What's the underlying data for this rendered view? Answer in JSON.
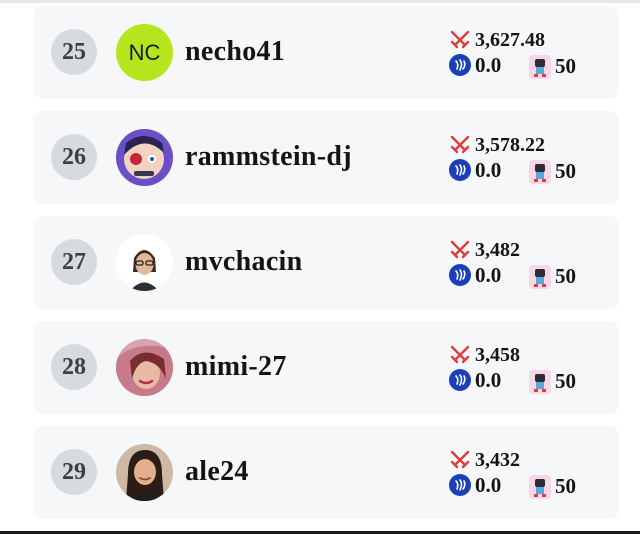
{
  "rows": [
    {
      "rank": "25",
      "username": "necho41",
      "avatar": {
        "kind": "initials",
        "initials": "NC",
        "bg": "#b5e61d"
      },
      "battle_power": "3,627.48",
      "steem_balance": "0.0",
      "cards": "50"
    },
    {
      "rank": "26",
      "username": "rammstein-dj",
      "avatar": {
        "kind": "image",
        "icon": "pirate-cartoon-avatar"
      },
      "battle_power": "3,578.22",
      "steem_balance": "0.0",
      "cards": "50"
    },
    {
      "rank": "27",
      "username": "mvchacin",
      "avatar": {
        "kind": "image",
        "icon": "portrait-glasses-avatar"
      },
      "battle_power": "3,482",
      "steem_balance": "0.0",
      "cards": "50"
    },
    {
      "rank": "28",
      "username": "mimi-27",
      "avatar": {
        "kind": "image",
        "icon": "portrait-pink-avatar"
      },
      "battle_power": "3,458",
      "steem_balance": "0.0",
      "cards": "50"
    },
    {
      "rank": "29",
      "username": "ale24",
      "avatar": {
        "kind": "image",
        "icon": "portrait-woman-avatar"
      },
      "battle_power": "3,432",
      "steem_balance": "0.0",
      "cards": "50"
    }
  ],
  "icons": {
    "battle": "crossed-swords-icon",
    "steem": "steem-icon",
    "cards": "card-character-icon"
  },
  "colors": {
    "row_bg": "#f6f7f9",
    "rank_bg": "#d7dbe0",
    "sword_red": "#e23b3b",
    "steem_blue": "#1a3fb9",
    "card_pink": "#f7d6e6"
  }
}
